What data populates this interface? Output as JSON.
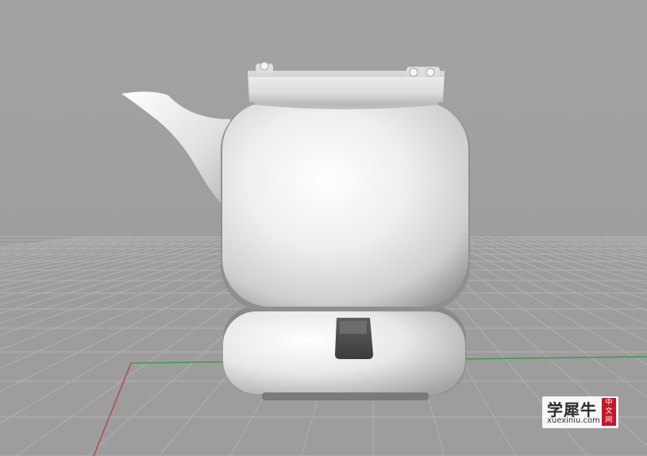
{
  "viewport": {
    "background_color": "#a2a2a2",
    "ground_color": "#9d9d9d",
    "grid_color": "#b3b3b3",
    "x_axis_color": "#3f9a4c",
    "y_axis_color": "#b04a4a"
  },
  "model": {
    "object": "teapot",
    "surface_color": "#e6e6e6"
  },
  "watermark": {
    "brand": "学犀牛",
    "site": "xuexiniu.com",
    "badge": [
      "中",
      "文",
      "网"
    ],
    "badge_color": "#c3172a"
  }
}
